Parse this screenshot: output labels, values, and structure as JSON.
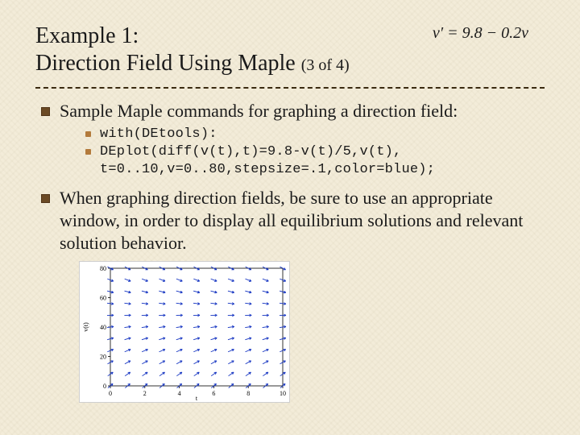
{
  "title": {
    "line1": "Example 1:",
    "line2_main": "Direction Field Using Maple",
    "line2_suffix": "(3 of 4)"
  },
  "equation": "v′ = 9.8 − 0.2v",
  "bullets": {
    "b1": "Sample Maple commands for graphing a direction field:",
    "code1": "with(DEtools):",
    "code2": "DEplot(diff(v(t),t)=9.8-v(t)/5,v(t),",
    "code3": "t=0..10,v=0..80,stepsize=.1,color=blue);",
    "b2": "When graphing direction fields, be sure to use an appropriate window, in order to display all equilibrium solutions and relevant solution behavior."
  },
  "chart_data": {
    "type": "direction-field",
    "title": "",
    "xlabel": "t",
    "ylabel": "v(t)",
    "xlim": [
      0,
      10
    ],
    "ylim": [
      0,
      80
    ],
    "x_ticks": [
      0,
      2,
      4,
      6,
      8,
      10
    ],
    "y_ticks": [
      0,
      20,
      40,
      60,
      80
    ],
    "v_sample_rows": [
      0,
      8,
      16,
      24,
      32,
      40,
      48,
      56,
      64,
      72,
      80
    ],
    "t_sample_cols": [
      0,
      1,
      2,
      3,
      4,
      5,
      6,
      7,
      8,
      9,
      10
    ],
    "slope_formula": "dv/dt = 9.8 - 0.2*v",
    "equilibrium_v": 49,
    "arrow_color": "#1030c0",
    "plot_notes": "Field arrows slope upward for v<49, nearly horizontal near v≈49, slope downward for v>49."
  }
}
